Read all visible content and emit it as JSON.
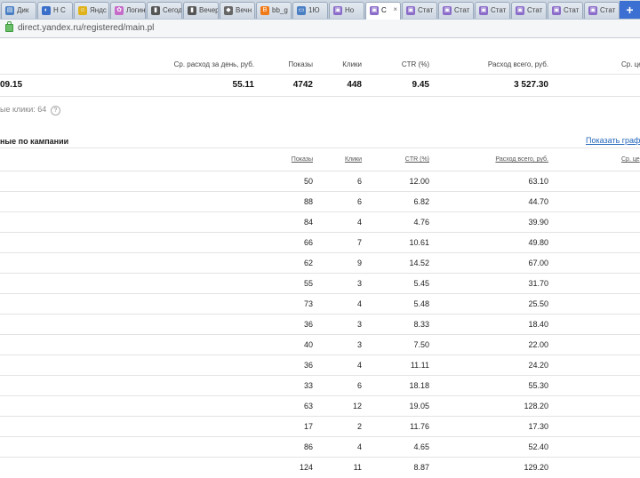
{
  "browser": {
    "tabs": [
      {
        "label": "Дик",
        "icon": "document-icon",
        "color": "#4a7fc4"
      },
      {
        "label": "Н С",
        "icon": "chat-icon",
        "color": "#3a6fc9"
      },
      {
        "label": "Яндс",
        "icon": "smiley-icon",
        "color": "#e0b21c"
      },
      {
        "label": "Логин",
        "icon": "flower-icon",
        "color": "#c66bc9"
      },
      {
        "label": "Сегод",
        "icon": "bookmark-icon",
        "color": "#555555"
      },
      {
        "label": "Вечер",
        "icon": "bookmark-icon",
        "color": "#555555"
      },
      {
        "label": "Вечн",
        "icon": "shield-icon",
        "color": "#666666"
      },
      {
        "label": "bb_g",
        "icon": "blogger-icon",
        "color": "#f07a18"
      },
      {
        "label": "1Ю",
        "icon": "window-icon",
        "color": "#4a7fc4"
      },
      {
        "label": "Но",
        "icon": "page-icon",
        "color": "#8b6cc9"
      },
      {
        "label": "С",
        "icon": "page-icon",
        "color": "#8b6cc9",
        "active": true
      },
      {
        "label": "Стат",
        "icon": "page-icon",
        "color": "#8b6cc9"
      },
      {
        "label": "Стат",
        "icon": "page-icon",
        "color": "#8b6cc9"
      },
      {
        "label": "Стат",
        "icon": "page-icon",
        "color": "#8b6cc9"
      },
      {
        "label": "Стат",
        "icon": "page-icon",
        "color": "#8b6cc9"
      },
      {
        "label": "Стат",
        "icon": "page-icon",
        "color": "#8b6cc9"
      },
      {
        "label": "Стат",
        "icon": "page-icon",
        "color": "#8b6cc9"
      }
    ],
    "new_tab": "+",
    "url": "direct.yandex.ru/registered/main.pl"
  },
  "summary": {
    "headers": {
      "avg_day": "Ср. расход за день, руб.",
      "shows": "Показы",
      "clicks": "Клики",
      "ctr": "CTR (%)",
      "total": "Расход всего, руб.",
      "avg_price": "Ср. це"
    },
    "values": {
      "first": "09.15",
      "avg_day": "55.11",
      "shows": "4742",
      "clicks": "448",
      "ctr": "9.45",
      "total": "3 527.30"
    },
    "clicks_note": "ые клики: 64"
  },
  "section": {
    "title": "ные по кампании",
    "graph_link": "Показать графи"
  },
  "table": {
    "headers": {
      "shows": "Показы",
      "clicks": "Клики",
      "ctr": "CTR (%)",
      "total": "Расход всего, руб.",
      "avg_price": "Ср. це"
    },
    "rows": [
      {
        "shows": "50",
        "clicks": "6",
        "ctr": "12.00",
        "total": "63.10"
      },
      {
        "shows": "88",
        "clicks": "6",
        "ctr": "6.82",
        "total": "44.70"
      },
      {
        "shows": "84",
        "clicks": "4",
        "ctr": "4.76",
        "total": "39.90"
      },
      {
        "shows": "66",
        "clicks": "7",
        "ctr": "10.61",
        "total": "49.80"
      },
      {
        "shows": "62",
        "clicks": "9",
        "ctr": "14.52",
        "total": "67.00"
      },
      {
        "shows": "55",
        "clicks": "3",
        "ctr": "5.45",
        "total": "31.70"
      },
      {
        "shows": "73",
        "clicks": "4",
        "ctr": "5.48",
        "total": "25.50"
      },
      {
        "shows": "36",
        "clicks": "3",
        "ctr": "8.33",
        "total": "18.40"
      },
      {
        "shows": "40",
        "clicks": "3",
        "ctr": "7.50",
        "total": "22.00"
      },
      {
        "shows": "36",
        "clicks": "4",
        "ctr": "11.11",
        "total": "24.20"
      },
      {
        "shows": "33",
        "clicks": "6",
        "ctr": "18.18",
        "total": "55.30"
      },
      {
        "shows": "63",
        "clicks": "12",
        "ctr": "19.05",
        "total": "128.20"
      },
      {
        "shows": "17",
        "clicks": "2",
        "ctr": "11.76",
        "total": "17.30"
      },
      {
        "shows": "86",
        "clicks": "4",
        "ctr": "4.65",
        "total": "52.40"
      },
      {
        "shows": "124",
        "clicks": "11",
        "ctr": "8.87",
        "total": "129.20"
      }
    ]
  }
}
